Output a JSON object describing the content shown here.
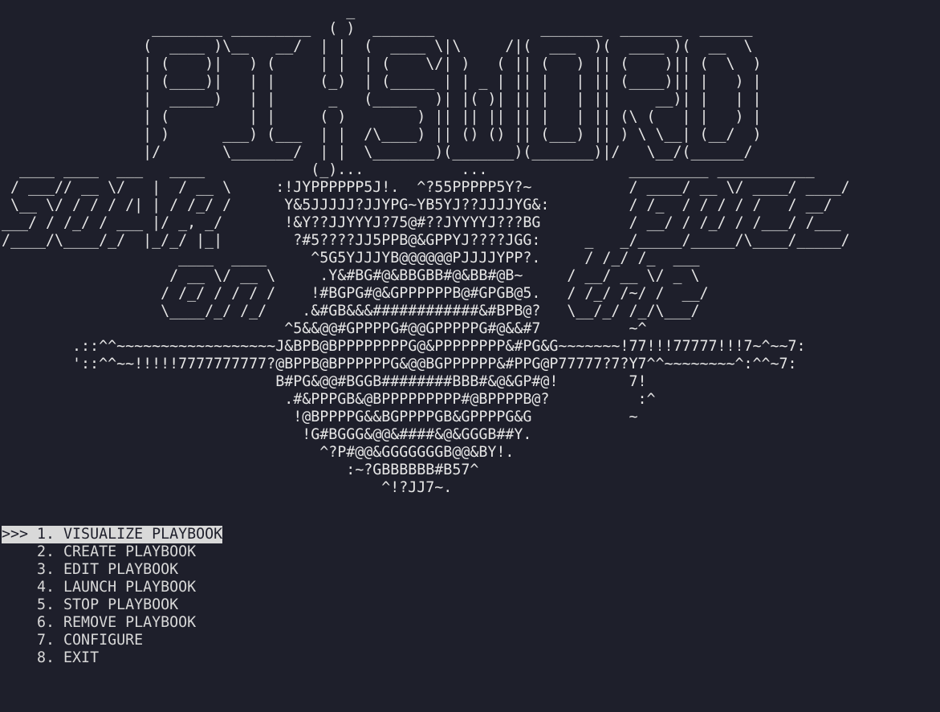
{
  "colors": {
    "background": "#1e1f2b",
    "foreground": "#e6e6e6",
    "selection_bg": "#d9d9d9",
    "selection_fg": "#1e1f2b"
  },
  "banner": {
    "lines": [
      "                                       _",
      "                 ________ _________  ( )  _______            _______  _______  ______",
      "                (  ____ )\\__   __/  | |  (  ____ \\|\\     /|(  ___  )(  ____ )(  __  \\",
      "                | (    )|   ) (     | |  | (    \\/| )   ( || (   ) || (    )|| (  \\  )",
      "                | (____)|   | |     (_)  | (_____ | | _ | || |   | || (____)|| |   ) |",
      "                |  _____)   | |      _   (_____  )| |( )| || |   | ||     __)| |   | |",
      "                | (         | |     ( )        ) || || || || |   | || (\\ (   | |   ) |",
      "                | )      ___) (___  | |  /\\____) || () () || (___) || ) \\ \\__| (__/  )",
      "                |/       \\_______/  | |  \\_______)(_______)(_______)|/   \\__/(______/",
      "  ____ ____  ___   ____            (_)...           ...                _________ ___________",
      " / ___// __ \\/   |  / __ \\     :!JYPPPPPP5J!.  ^?55PPPPP5Y?~           / ____/ __ \\/ ____/ ____/",
      " \\__ \\/ / / / /| | / /_/ /      Y&5JJJJJ?JJYPG~YB5YJ??JJJJYG&:         / /_  / / / / /   / __/",
      "___/ / /_/ / ___ |/ _, _/       !&Y??JJYYYJ?75@#??JYYYYJ???BG          / __/ / /_/ / /___/ /___",
      "/____/\\____/_/  |_/_/ |_|        ?#5????JJ5PPB@&GPPYJ????JGG:     _   _/_____/_____/\\____/_____/",
      "                    ____  ____     ^5G5YJJJYB@@@@@@PJJJJYPP?.     / /_/ /_  ___",
      "                   / __ \\/ __ \\     .Y&#BG#@&BBGBB#@&BB#@B~     / __/ __ \\/ _ \\",
      "                  / /_/ / / / /    !#BGPG#@&GPPPPPPB@#GPGB@5.   / /_/ /~/ /  __/",
      "                  \\____/_/ /_/    .&#GB&&&############&#BPB@?   \\__/_/ /_/\\___/",
      "                                ^5&&@@#GPPPPG#@@GPPPPPG#@&&#7          ~^",
      "        .::^^~~~~~~~~~~~~~~~~~~J&BPB@BPPPPPPPPG@&PPPPPPPP&#PG&G~~~~~~~!77!!!77777!!!7~^~~7:",
      "        '::^^~~!!!!!7777777777?@BPPB@BPPPPPPG&@@BGPPPPPP&#PPG@P77777?7?Y7^^~~~~~~~~^:^^~7:",
      "                               B#PG&@@#BGGB########BBB#&@&GP#@!        7!",
      "                                .#&PPPGB&@BPPPPPPPPP#@BPPPPB@?          :^",
      "                                 !@BPPPPG&&BGPPPPGB&GPPPPG&G           ~",
      "                                  !G#BGGG&@@&####&@&GGGB##Y.",
      "                                    ^?P#@@&GGGGGGGB@@&BY!.",
      "                                       :~?GBBBBBB#B57^",
      "                                           ^!?JJ7~."
    ]
  },
  "menu": {
    "pointer": ">>> ",
    "indent": "    ",
    "items": [
      {
        "label": "1. VISUALIZE PLAYBOOK",
        "selected": true
      },
      {
        "label": "2. CREATE PLAYBOOK",
        "selected": false
      },
      {
        "label": "3. EDIT PLAYBOOK",
        "selected": false
      },
      {
        "label": "4. LAUNCH PLAYBOOK",
        "selected": false
      },
      {
        "label": "5. STOP PLAYBOOK",
        "selected": false
      },
      {
        "label": "6. REMOVE PLAYBOOK",
        "selected": false
      },
      {
        "label": "7. CONFIGURE",
        "selected": false
      },
      {
        "label": "8. EXIT",
        "selected": false
      }
    ]
  }
}
